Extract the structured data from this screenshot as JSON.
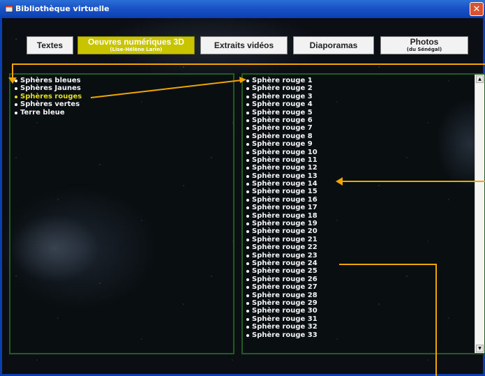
{
  "window": {
    "title": "Bibliothèque virtuelle",
    "close_glyph": "✕"
  },
  "tabs": [
    {
      "label": "Textes",
      "sub": "",
      "active": false
    },
    {
      "label": "Oeuvres numériques 3D",
      "sub": "(Lise-Hélène Larin)",
      "active": true
    },
    {
      "label": "Extraits vidéos",
      "sub": "",
      "active": false
    },
    {
      "label": "Diaporamas",
      "sub": "",
      "active": false
    },
    {
      "label": "Photos",
      "sub": "(du Sénégal)",
      "active": false
    }
  ],
  "categories": {
    "items": [
      "Sphères bleues",
      "Sphères Jaunes",
      "Sphères rouges",
      "Sphères vertes",
      "Terre bleue"
    ],
    "selected_index": 2
  },
  "items": {
    "list": [
      "Sphère rouge 1",
      "Sphère rouge 2",
      "Sphère rouge 3",
      "Sphère rouge 4",
      "Sphère rouge 5",
      "Sphère rouge 6",
      "Sphère rouge 7",
      "Sphère rouge 8",
      "Sphère rouge 9",
      "Sphère rouge 10",
      "Sphère rouge 11",
      "Sphère rouge 12",
      "Sphère rouge 13",
      "Sphère rouge 14",
      "Sphère rouge 15",
      "Sphère rouge 16",
      "Sphère rouge 17",
      "Sphère rouge 18",
      "Sphère rouge 19",
      "Sphère rouge 20",
      "Sphère rouge 21",
      "Sphère rouge 22",
      "Sphère rouge 23",
      "Sphère rouge 24",
      "Sphère rouge 25",
      "Sphère rouge 26",
      "Sphère rouge 27",
      "Sphère rouge 28",
      "Sphère rouge 29",
      "Sphère rouge 30",
      "Sphère rouge 31",
      "Sphère rouge 32",
      "Sphère rouge 33"
    ]
  },
  "colors": {
    "active_tab": "#c8c500",
    "selected_text": "#e4df1e",
    "panel_border": "#1f5e1f",
    "annotation": "#f0a500",
    "titlebar": "#1c56c8"
  },
  "icons": {
    "app": "app-window-icon",
    "close": "close-icon",
    "scroll_up": "scroll-up-arrow-icon",
    "scroll_down": "scroll-down-arrow-icon"
  }
}
